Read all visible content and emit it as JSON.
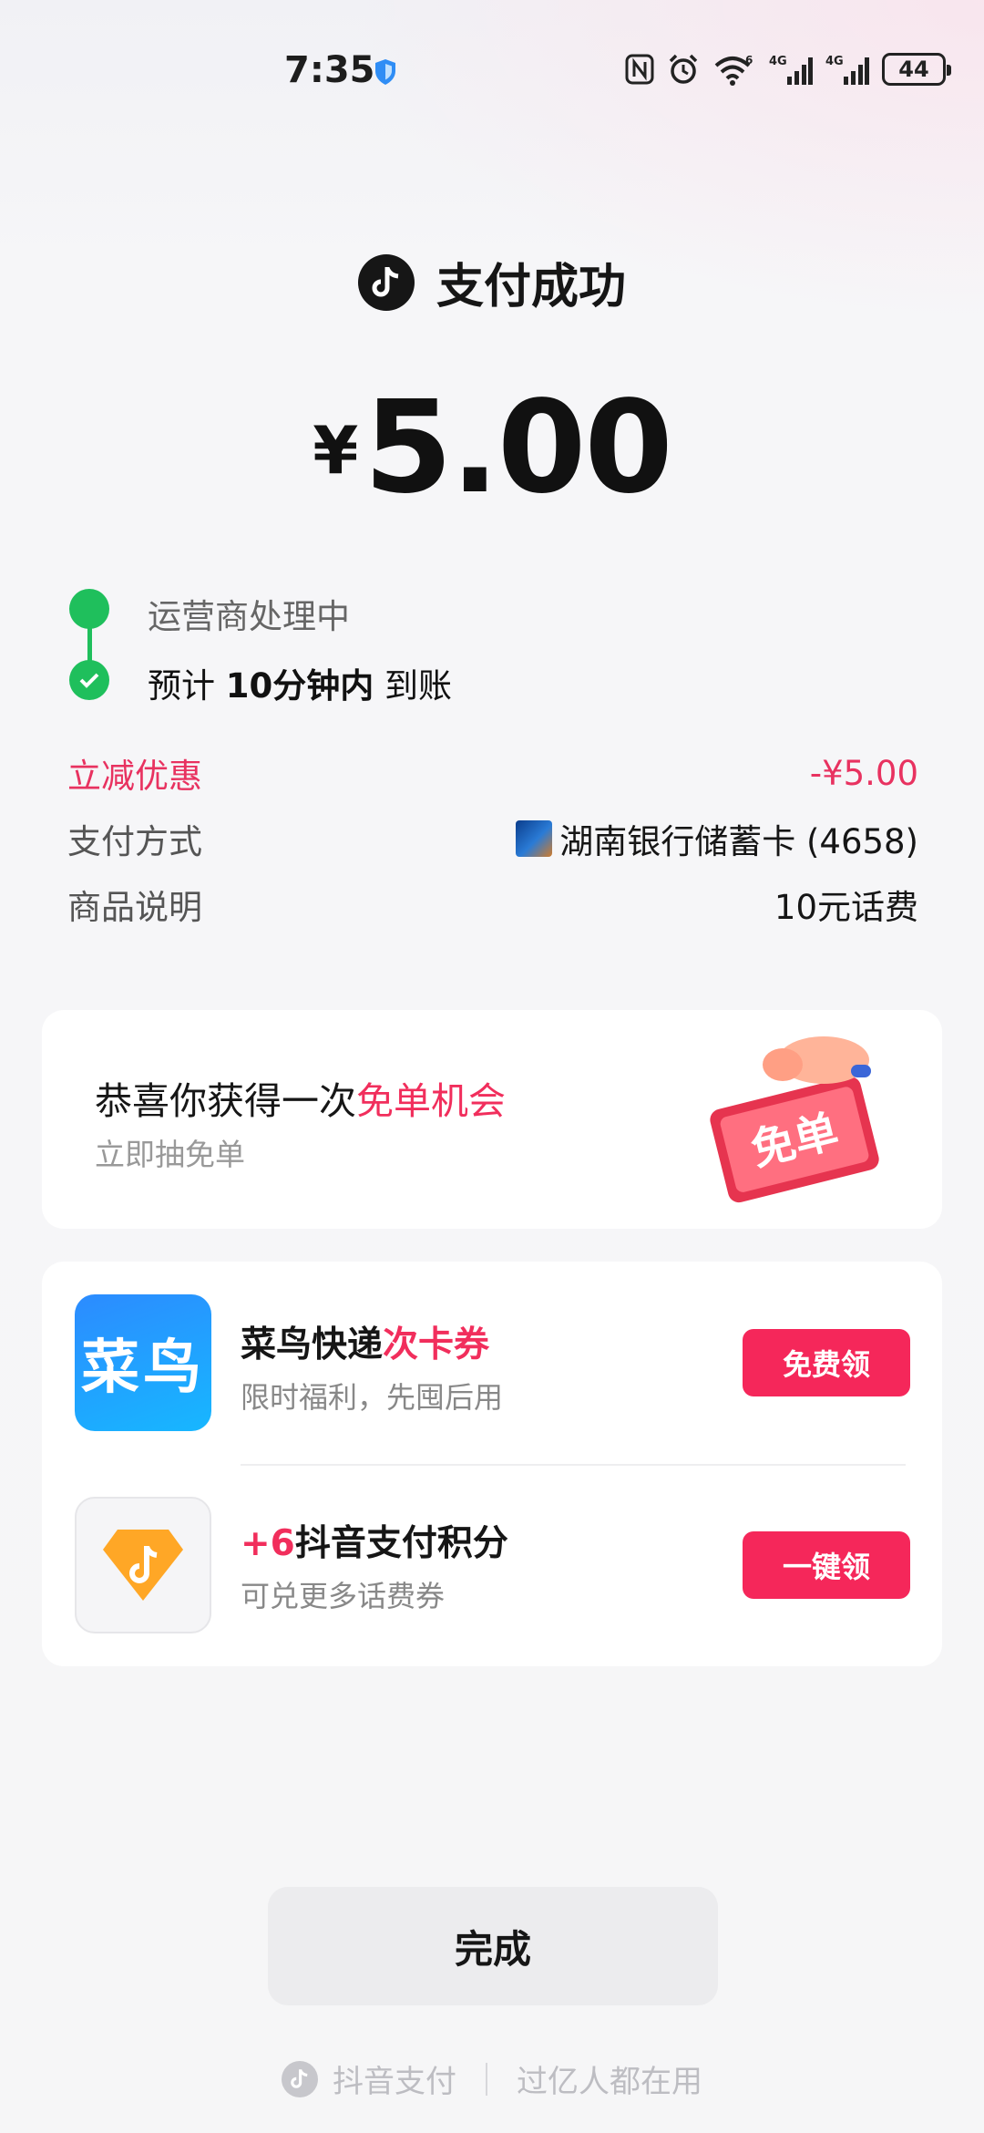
{
  "status_bar": {
    "time": "7:35",
    "battery": "44",
    "icons": [
      "shield-icon",
      "nfc-icon",
      "alarm-icon",
      "wifi-icon",
      "signal-4g-icon",
      "signal-4g-icon"
    ],
    "wifi_badge": "6",
    "net1": "4G",
    "net2": "4G"
  },
  "header": {
    "logo": "douyin-logo-icon",
    "title": "支付成功"
  },
  "amount": {
    "currency": "¥",
    "value": "5.00"
  },
  "timeline": {
    "step1": "运营商处理中",
    "step2_prefix": "预计 ",
    "step2_bold": "10分钟内",
    "step2_suffix": " 到账",
    "accent": "#1fbf5c"
  },
  "details": {
    "discount_label": "立减优惠",
    "discount_value": "-¥5.00",
    "payment_label": "支付方式",
    "payment_value": "湖南银行储蓄卡 (4658)",
    "product_label": "商品说明",
    "product_value": "10元话费"
  },
  "promo": {
    "title_prefix": "恭喜你获得一次",
    "title_highlight": "免单机会",
    "subtitle": "立即抽免单",
    "badge_text": "免单"
  },
  "offers": [
    {
      "icon_text": "菜鸟",
      "title_prefix": "菜鸟快递",
      "title_highlight": "次卡券",
      "subtitle": "限时福利，先囤后用",
      "button": "免费领"
    },
    {
      "title_highlight": "+6",
      "title_suffix": "抖音支付积分",
      "subtitle": "可兑更多话费券",
      "button": "一键领"
    }
  ],
  "done_button": "完成",
  "footer": {
    "brand": "抖音支付",
    "slogan": "过亿人都在用"
  },
  "colors": {
    "accent_red": "#f5275a",
    "success_green": "#1fbf5c"
  }
}
